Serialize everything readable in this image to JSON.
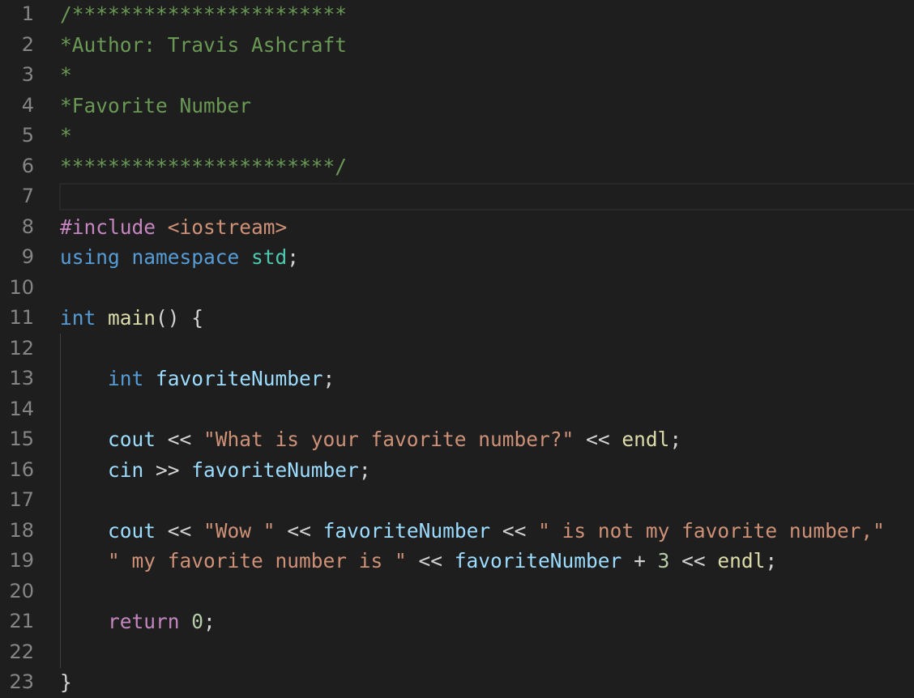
{
  "editor": {
    "background": "#1e1e1e",
    "line_numbers": [
      "1",
      "2",
      "3",
      "4",
      "5",
      "6",
      "7",
      "8",
      "9",
      "10",
      "11",
      "12",
      "13",
      "14",
      "15",
      "16",
      "17",
      "18",
      "19",
      "20",
      "21",
      "22",
      "23"
    ],
    "lines": [
      [
        {
          "t": "/***********************",
          "c": "cm"
        }
      ],
      [
        {
          "t": "*Author: Travis Ashcraft",
          "c": "cm"
        }
      ],
      [
        {
          "t": "*",
          "c": "cm"
        }
      ],
      [
        {
          "t": "*Favorite Number",
          "c": "cm"
        }
      ],
      [
        {
          "t": "*",
          "c": "cm"
        }
      ],
      [
        {
          "t": "***********************/",
          "c": "cm"
        }
      ],
      [],
      [
        {
          "t": "#include ",
          "c": "pp"
        },
        {
          "t": "<iostream>",
          "c": "str"
        }
      ],
      [
        {
          "t": "using ",
          "c": "kw"
        },
        {
          "t": "namespace ",
          "c": "kw"
        },
        {
          "t": "std",
          "c": "ns"
        },
        {
          "t": ";",
          "c": "pl"
        }
      ],
      [],
      [
        {
          "t": "int ",
          "c": "kw"
        },
        {
          "t": "main",
          "c": "fn"
        },
        {
          "t": "() {",
          "c": "pl"
        }
      ],
      [],
      [
        {
          "t": "    ",
          "c": "pl"
        },
        {
          "t": "int ",
          "c": "kw"
        },
        {
          "t": "favoriteNumber",
          "c": "var"
        },
        {
          "t": ";",
          "c": "pl"
        }
      ],
      [],
      [
        {
          "t": "    ",
          "c": "pl"
        },
        {
          "t": "cout",
          "c": "var"
        },
        {
          "t": " << ",
          "c": "pl"
        },
        {
          "t": "\"What is your favorite number?\"",
          "c": "str"
        },
        {
          "t": " << ",
          "c": "pl"
        },
        {
          "t": "endl",
          "c": "fn"
        },
        {
          "t": ";",
          "c": "pl"
        }
      ],
      [
        {
          "t": "    ",
          "c": "pl"
        },
        {
          "t": "cin",
          "c": "var"
        },
        {
          "t": " >> ",
          "c": "pl"
        },
        {
          "t": "favoriteNumber",
          "c": "var"
        },
        {
          "t": ";",
          "c": "pl"
        }
      ],
      [],
      [
        {
          "t": "    ",
          "c": "pl"
        },
        {
          "t": "cout",
          "c": "var"
        },
        {
          "t": " << ",
          "c": "pl"
        },
        {
          "t": "\"Wow \"",
          "c": "str"
        },
        {
          "t": " << ",
          "c": "pl"
        },
        {
          "t": "favoriteNumber",
          "c": "var"
        },
        {
          "t": " << ",
          "c": "pl"
        },
        {
          "t": "\" is not my favorite number,\"",
          "c": "str"
        }
      ],
      [
        {
          "t": "    ",
          "c": "pl"
        },
        {
          "t": "\" my favorite number is \"",
          "c": "str"
        },
        {
          "t": " << ",
          "c": "pl"
        },
        {
          "t": "favoriteNumber",
          "c": "var"
        },
        {
          "t": " + ",
          "c": "pl"
        },
        {
          "t": "3",
          "c": "num"
        },
        {
          "t": " << ",
          "c": "pl"
        },
        {
          "t": "endl",
          "c": "fn"
        },
        {
          "t": ";",
          "c": "pl"
        }
      ],
      [],
      [
        {
          "t": "    ",
          "c": "pl"
        },
        {
          "t": "return ",
          "c": "ctl"
        },
        {
          "t": "0",
          "c": "num"
        },
        {
          "t": ";",
          "c": "pl"
        }
      ],
      [],
      [
        {
          "t": "}",
          "c": "pl"
        }
      ]
    ]
  },
  "colors": {
    "comment": "#6a9955",
    "preprocessor": "#c586c0",
    "keyword": "#569cd6",
    "function": "#dcdcaa",
    "variable": "#9cdcfe",
    "string": "#ce9178",
    "number": "#b5cea8",
    "namespace": "#4ec9b0",
    "line_number": "#858585"
  }
}
